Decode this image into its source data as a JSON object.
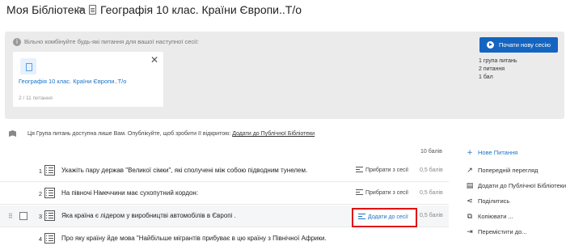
{
  "breadcrumb": {
    "root": "Моя Бібліотека",
    "separator": ">",
    "title": "Географія 10 клас. Країни Європи..Т/о"
  },
  "session_panel": {
    "info": "Вільно комбінуйте будь-які питання для вашої наступної сесії:",
    "card": {
      "title": "Географія 10 клас. Країни Європи..Т/о",
      "count": "2 / 11 питання",
      "close": "✕"
    },
    "start_button": "Почати нову сесію",
    "summary": [
      "1 група питань",
      "2 питання",
      "1 бал"
    ]
  },
  "notice": {
    "text": "Ця Група питань доступна лише Вам. Опублікуйте, щоб зробити її відкритою:",
    "link": "Додати до Публічної Бібліотеки"
  },
  "total_points": "10 балів",
  "questions": [
    {
      "num": "1",
      "text": "Укажіть пару держав \"Великої сімки\", які сполучені між собою підводним тунелем.",
      "action": "Прибрати з сесії",
      "points": "0,5 балів"
    },
    {
      "num": "2",
      "text": "На півночі Німеччини має сухопутний кордон:",
      "action": "Прибрати з сесії",
      "points": "0,5 балів"
    },
    {
      "num": "3",
      "text": "Яка країна є лідером у виробництві автомобілів в Європі .",
      "action": "Додати до сесії",
      "points": "0,5 балів"
    },
    {
      "num": "4",
      "text": "Про яку країну йде мова \"Найбільше мігрантів прибуває в цю країну з Північної Африки.",
      "action": "",
      "points": ""
    }
  ],
  "sidebar": {
    "new_question": "Нове Питання",
    "preview": "Попередній перегляд",
    "add_public": "Додати до Публічної Бібліотеки",
    "share": "Поділитись",
    "copy": "Копіювати ...",
    "move": "Перемістити до..."
  }
}
